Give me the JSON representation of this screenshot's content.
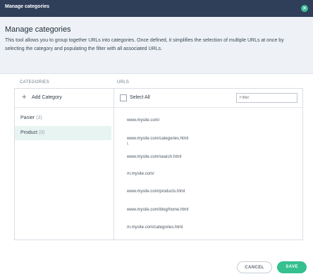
{
  "window": {
    "title": "Manage categories",
    "close_icon": "close-icon"
  },
  "header": {
    "title": "Manage categories",
    "description": "This tool allows you to group together URLs into categories. Once defined, it simplifies the selection of multiple URLs at once by selecting the category and populating the filter with all associated URLs."
  },
  "columns": {
    "categories": "CATEGORIES",
    "urls": "URLS"
  },
  "categories": {
    "add_label": "Add Category",
    "add_icon": "plus-icon",
    "items": [
      {
        "name": "Panier",
        "count": "(3)",
        "selected": false
      },
      {
        "name": "Product",
        "count": "(0)",
        "selected": true
      }
    ]
  },
  "urls": {
    "select_all_label": "Select All",
    "filter_placeholder": "Filter",
    "items": [
      "www.mysite.com/",
      "www.mysite.com/categories.html\n\\",
      "www.mysite.com/search.html",
      "m.mysite.com/",
      "www.mysite.com/products.html",
      "www.mystie.com/blog/home.html",
      "m.mysite.com/categories.html"
    ]
  },
  "footer": {
    "cancel_label": "CANCEL",
    "save_label": "SAVE"
  },
  "colors": {
    "titlebar": "#2f3f5a",
    "accent": "#34c08f",
    "selected_bg": "#e7f4f1"
  }
}
